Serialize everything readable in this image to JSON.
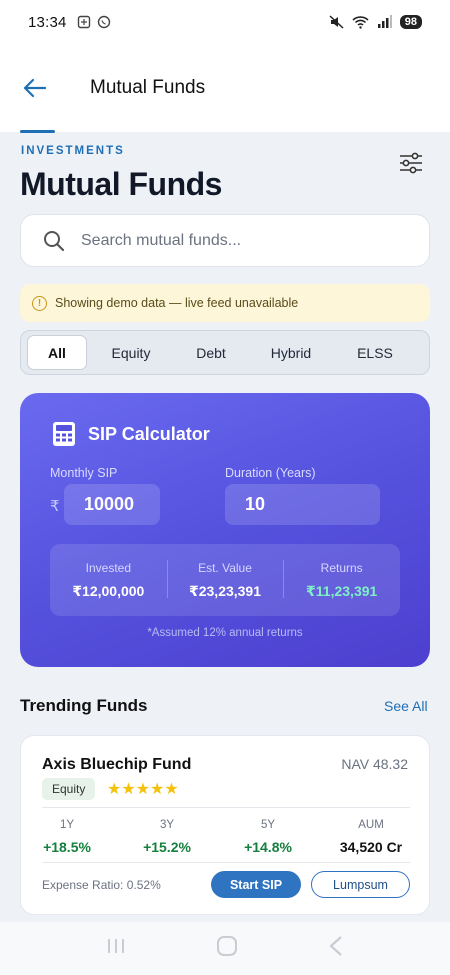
{
  "status_bar": {
    "time": "13:34",
    "battery": "98"
  },
  "app_bar": {
    "title": "Mutual Funds"
  },
  "header": {
    "eyebrow": "INVESTMENTS",
    "title": "Mutual Funds"
  },
  "search": {
    "placeholder": "Search mutual funds..."
  },
  "banner": {
    "text": "Showing demo data — live feed unavailable"
  },
  "segments": [
    {
      "label": "All",
      "active": true
    },
    {
      "label": "Equity"
    },
    {
      "label": "Debt"
    },
    {
      "label": "Hybrid"
    },
    {
      "label": "ELSS"
    }
  ],
  "sip": {
    "title": "SIP Calculator",
    "monthly_label": "Monthly SIP",
    "monthly_value": "10000",
    "currency": "₹",
    "duration_label": "Duration (Years)",
    "duration_value": "10",
    "results": [
      {
        "label": "Invested",
        "value": "₹12,00,000"
      },
      {
        "label": "Est. Value",
        "value": "₹23,23,391"
      },
      {
        "label": "Returns",
        "value": "₹11,23,391"
      }
    ],
    "footnote": "*Assumed 12% annual returns"
  },
  "trending": {
    "title": "Trending Funds",
    "see_all": "See All"
  },
  "fund": {
    "name": "Axis Bluechip Fund",
    "nav": "NAV 48.32",
    "category": "Equity",
    "rating_stars": "★★★★★",
    "stats": [
      {
        "label": "1Y",
        "value": "+18.5%"
      },
      {
        "label": "3Y",
        "value": "+15.2%"
      },
      {
        "label": "5Y",
        "value": "+14.8%"
      },
      {
        "label": "AUM",
        "value": "34,520 Cr"
      }
    ],
    "expense": "Expense Ratio: 0.52%",
    "start_sip": "Start SIP",
    "lumpsum": "Lumpsum"
  },
  "colors": {
    "accent": "#1f6fb5",
    "sip_gradient_start": "#6a6af0",
    "sip_gradient_end": "#4d3fcf",
    "positive": "#15803d"
  }
}
